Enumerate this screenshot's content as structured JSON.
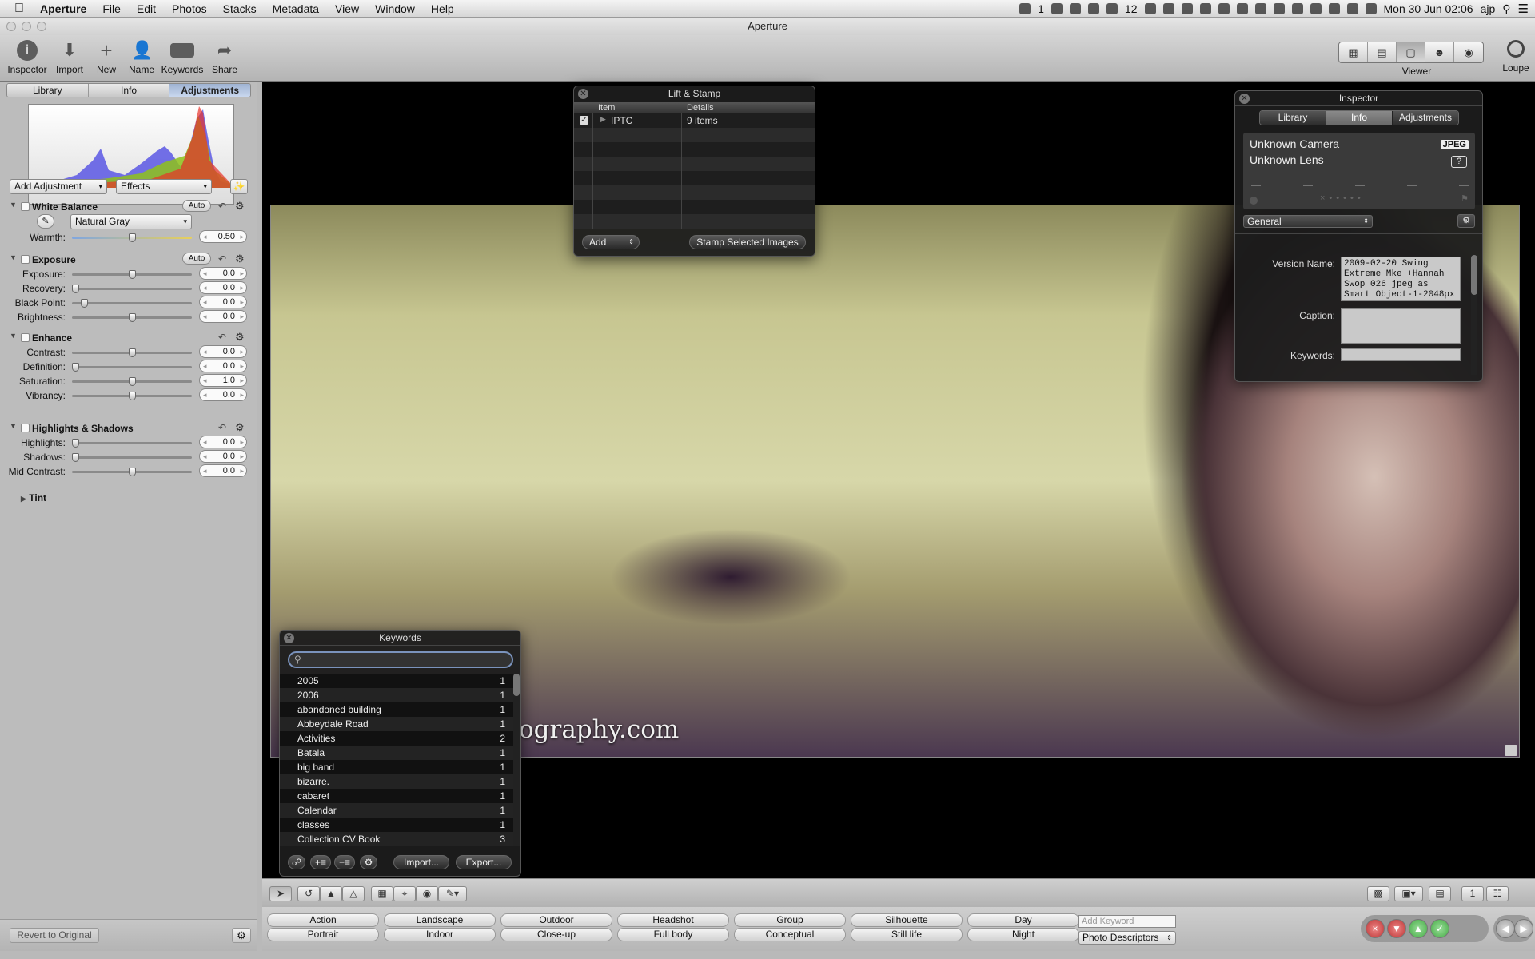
{
  "menubar": {
    "apple": "",
    "items": [
      "Aperture",
      "File",
      "Edit",
      "Photos",
      "Stacks",
      "Metadata",
      "View",
      "Window",
      "Help"
    ],
    "status": {
      "notif_count": "1",
      "badge_12": "12",
      "clock": "Mon 30 Jun  02:06",
      "user": "ajp"
    }
  },
  "window": {
    "title": "Aperture"
  },
  "toolbar": {
    "buttons": [
      "Inspector",
      "Import",
      "New",
      "Name",
      "Keywords",
      "Share"
    ],
    "viewer_label": "Viewer",
    "loupe_label": "Loupe"
  },
  "left": {
    "tabs": [
      "Library",
      "Info",
      "Adjustments"
    ],
    "active_tab": "Adjustments",
    "add_adjustment": "Add Adjustment",
    "effects": "Effects",
    "white_balance": {
      "title": "White Balance",
      "auto": "Auto",
      "preset": "Natural Gray",
      "warmth_label": "Warmth:",
      "warmth_value": "0.50",
      "warmth_pos": 0.5
    },
    "exposure": {
      "title": "Exposure",
      "auto": "Auto",
      "rows": [
        {
          "label": "Exposure:",
          "value": "0.0",
          "pos": 0.5
        },
        {
          "label": "Recovery:",
          "value": "0.0",
          "pos": 0.0
        },
        {
          "label": "Black Point:",
          "value": "0.0",
          "pos": 0.08
        },
        {
          "label": "Brightness:",
          "value": "0.0",
          "pos": 0.5
        }
      ]
    },
    "enhance": {
      "title": "Enhance",
      "rows": [
        {
          "label": "Contrast:",
          "value": "0.0",
          "pos": 0.5
        },
        {
          "label": "Definition:",
          "value": "0.0",
          "pos": 0.0
        },
        {
          "label": "Saturation:",
          "value": "1.0",
          "pos": 0.5
        },
        {
          "label": "Vibrancy:",
          "value": "0.0",
          "pos": 0.5
        }
      ],
      "tint": "Tint"
    },
    "highlights_shadows": {
      "title": "Highlights & Shadows",
      "rows": [
        {
          "label": "Highlights:",
          "value": "0.0",
          "pos": 0.0
        },
        {
          "label": "Shadows:",
          "value": "0.0",
          "pos": 0.0
        },
        {
          "label": "Mid Contrast:",
          "value": "0.0",
          "pos": 0.5
        }
      ]
    },
    "revert": "Revert to Original"
  },
  "photo": {
    "watermark": "ography.com"
  },
  "lift_stamp": {
    "title": "Lift & Stamp",
    "columns": [
      "Item",
      "Details"
    ],
    "rows": [
      {
        "item": "IPTC",
        "details": "9 items"
      }
    ],
    "add": "Add",
    "stamp": "Stamp Selected Images"
  },
  "keywords": {
    "title": "Keywords",
    "items": [
      {
        "name": "2005",
        "count": "1"
      },
      {
        "name": "2006",
        "count": "1"
      },
      {
        "name": "abandoned building",
        "count": "1"
      },
      {
        "name": "Abbeydale Road",
        "count": "1"
      },
      {
        "name": "Activities",
        "count": "2"
      },
      {
        "name": "Batala",
        "count": "1"
      },
      {
        "name": "big band",
        "count": "1"
      },
      {
        "name": "bizarre.",
        "count": "1"
      },
      {
        "name": "cabaret",
        "count": "1"
      },
      {
        "name": "Calendar",
        "count": "1"
      },
      {
        "name": "classes",
        "count": "1"
      },
      {
        "name": "Collection CV Book",
        "count": "3"
      }
    ],
    "import": "Import...",
    "export": "Export..."
  },
  "inspector": {
    "title": "Inspector",
    "tabs": [
      "Library",
      "Info",
      "Adjustments"
    ],
    "active_tab": "Info",
    "camera": "Unknown Camera",
    "lens": "Unknown Lens",
    "format": "JPEG",
    "lens_q": "?",
    "dashes": [
      "—",
      "—",
      "—",
      "—",
      "—"
    ],
    "preset": "General",
    "version_label": "Version Name:",
    "version_value": "2009-02-20 Swing Extreme Mke +Hannah Swop 026 jpeg as Smart Object-1-2048px",
    "caption_label": "Caption:",
    "keywords_label": "Keywords:"
  },
  "keyword_bar": {
    "row1": [
      "Action",
      "Landscape",
      "Outdoor",
      "Headshot",
      "Group",
      "Silhouette",
      "Day"
    ],
    "row2": [
      "Portrait",
      "Indoor",
      "Close-up",
      "Full body",
      "Conceptual",
      "Still life",
      "Night"
    ],
    "add_placeholder": "Add Keyword",
    "preset_group": "Photo Descriptors"
  }
}
